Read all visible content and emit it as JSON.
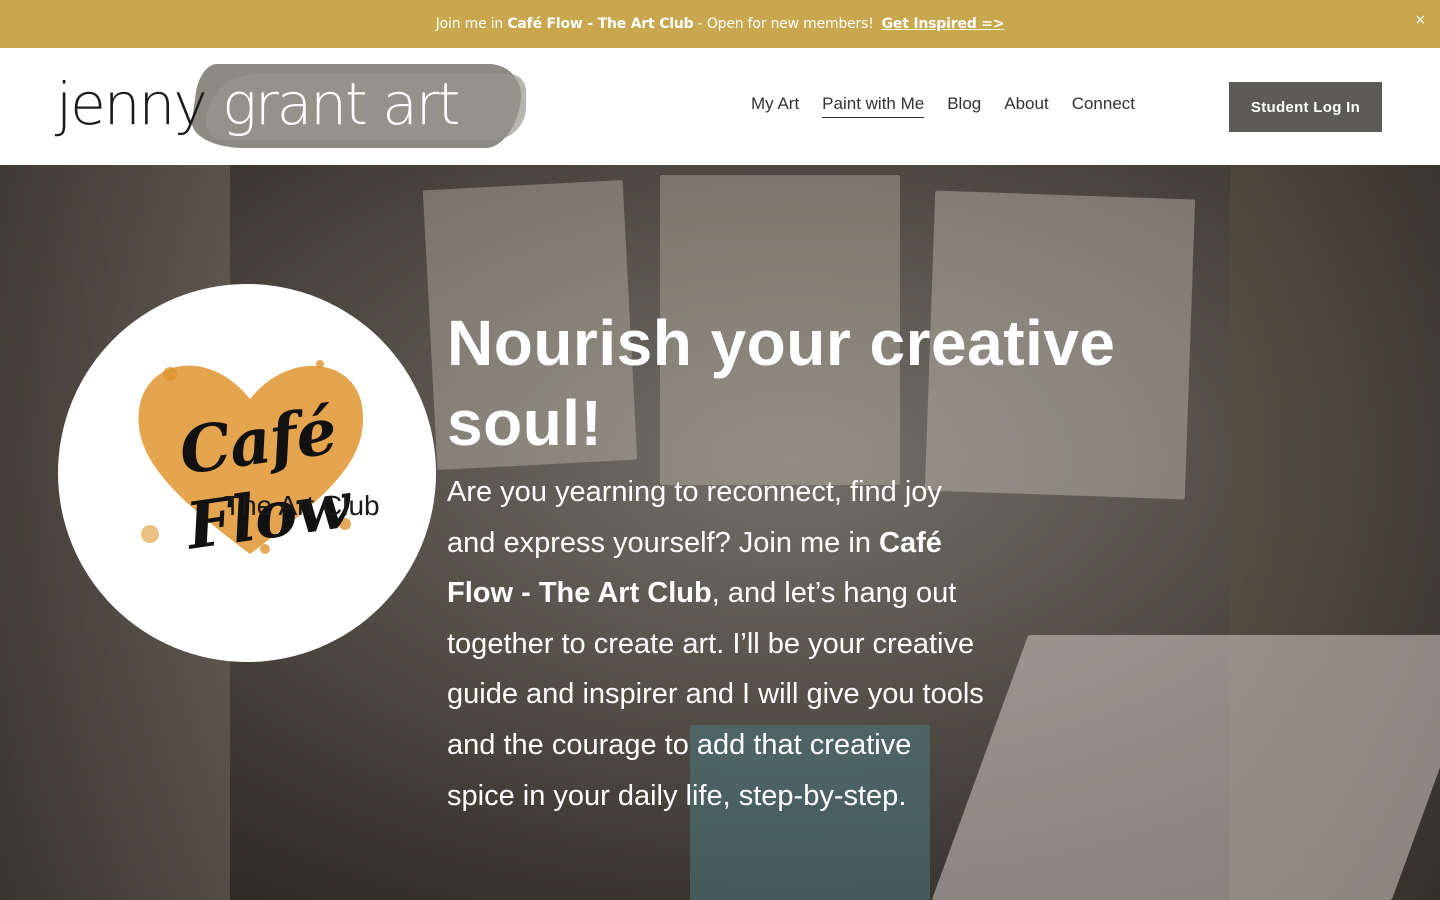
{
  "announcement": {
    "prefix": "Join me in ",
    "club_name": "Café Flow - The Art Club",
    "suffix": " - Open for new members!",
    "link_label": "Get Inspired =>",
    "close_label": "×"
  },
  "header": {
    "logo": {
      "part1": "jenny ",
      "part2": "grant art"
    },
    "nav": [
      {
        "label": "My Art",
        "active": false
      },
      {
        "label": "Paint with Me",
        "active": true
      },
      {
        "label": "Blog",
        "active": false
      },
      {
        "label": "About",
        "active": false
      },
      {
        "label": "Connect",
        "active": false
      }
    ],
    "login_label": "Student Log In"
  },
  "hero": {
    "badge": {
      "title": "Café Flow",
      "subtitle": "The Art Club"
    },
    "heading": "Nourish your creative soul!",
    "body_part1": "Are you yearning to reconnect, find joy and express yourself? Join me in ",
    "body_bold": "Café Flow - The Art Club",
    "body_part2": ", and let’s hang out together to create art.  I’ll be your creative guide and inspirer and I will give you tools and the courage to add that creative spice in your daily life, step-by-step."
  },
  "colors": {
    "announcement_bg": "#c8a74e",
    "button_bg": "#5c5b57",
    "heart_orange": "#e0942f"
  }
}
